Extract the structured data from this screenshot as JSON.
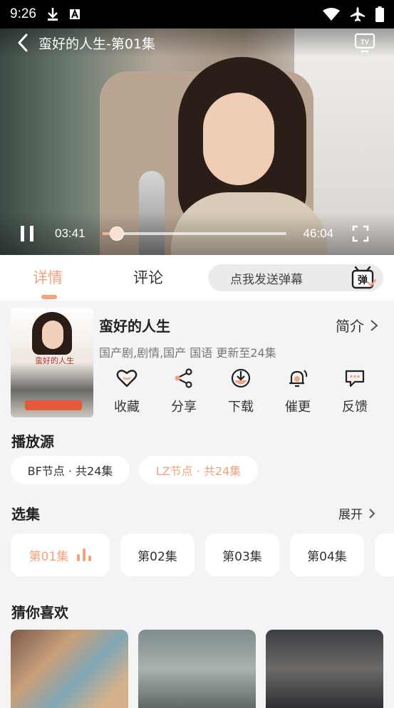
{
  "status_bar": {
    "time": "9:26"
  },
  "player": {
    "title": "蛮好的人生-第01集",
    "current_time": "03:41",
    "total_time": "46:04",
    "progress": 0.08,
    "accent": "#f2b38f"
  },
  "tabs": {
    "detail": "详情",
    "comments": "评论"
  },
  "danmu": {
    "placeholder": "点我发送弹幕",
    "icon_char": "弹"
  },
  "show": {
    "poster_title": "蛮好的人生",
    "title": "蛮好的人生",
    "intro_label": "简介",
    "meta": "国产剧,剧情,国产 国语 更新至24集"
  },
  "actions": [
    {
      "label": "收藏",
      "icon": "heart-icon"
    },
    {
      "label": "分享",
      "icon": "share-icon"
    },
    {
      "label": "下载",
      "icon": "download-icon"
    },
    {
      "label": "催更",
      "icon": "bell-icon"
    },
    {
      "label": "反馈",
      "icon": "feedback-icon"
    }
  ],
  "sources": {
    "title": "播放源",
    "items": [
      {
        "label": "BF节点 · 共24集"
      },
      {
        "label": "LZ节点 · 共24集",
        "active": true
      }
    ]
  },
  "episodes": {
    "title": "选集",
    "expand_label": "展开",
    "items": [
      "第01集",
      "第02集",
      "第03集",
      "第04集"
    ]
  },
  "recommend": {
    "title": "猜你喜欢"
  },
  "colors": {
    "accent": "#f2a27c",
    "background": "#f4f4f4"
  }
}
